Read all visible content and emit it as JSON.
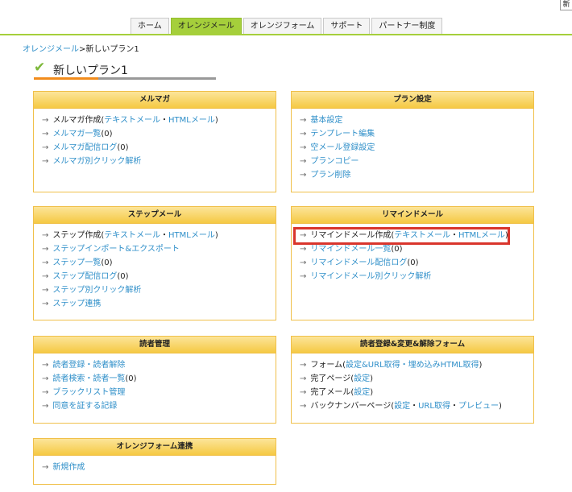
{
  "tabs": [
    "ホーム",
    "オレンジメール",
    "オレンジフォーム",
    "サポート",
    "パートナー制度"
  ],
  "active_tab": 1,
  "corner_mark": "新",
  "breadcrumb": {
    "link": "オレンジメール",
    "sep": ">",
    "current": "新しいプラン1"
  },
  "page_title": "新しいプラン1",
  "colors": {
    "accent_green": "#a5cf3b",
    "link_blue": "#2f8fc9",
    "panel_header": "#f5c943",
    "title_orange": "#f28c1c",
    "highlight_red": "#d9352c"
  },
  "panels": {
    "melmaga": {
      "title": "メルマガ",
      "create": {
        "label": "メルマガ作成",
        "open": "(",
        "text_link": "テキストメール",
        "dot": "・",
        "html_link": "HTMLメール",
        "close": ")"
      },
      "list": {
        "label": "メルマガ一覧",
        "count": "(0)"
      },
      "log": {
        "label": "メルマガ配信ログ",
        "count": "(0)"
      },
      "click": "メルマガ別クリック解析"
    },
    "plan": {
      "title": "プラン設定",
      "items": [
        "基本設定",
        "テンプレート編集",
        "空メール登録設定",
        "プランコピー",
        "プラン削除"
      ]
    },
    "step": {
      "title": "ステップメール",
      "create": {
        "label": "ステップ作成",
        "open": "(",
        "text_link": "テキストメール",
        "dot": "・",
        "html_link": "HTMLメール",
        "close": ")"
      },
      "import": "ステップインポート&エクスポート",
      "list": {
        "label": "ステップ一覧",
        "count": "(0)"
      },
      "log": {
        "label": "ステップ配信ログ",
        "count": "(0)"
      },
      "click": "ステップ別クリック解析",
      "link": "ステップ連携"
    },
    "remind": {
      "title": "リマインドメール",
      "create": {
        "label": "リマインドメール作成",
        "open": "(",
        "text_link": "テキストメール",
        "dot": "・",
        "html_link": "HTMLメール",
        "close": ")"
      },
      "list": {
        "label": "リマインドメール一覧",
        "count": "(0)"
      },
      "log": {
        "label": "リマインドメール配信ログ",
        "count": "(0)"
      },
      "click": "リマインドメール別クリック解析"
    },
    "reader": {
      "title": "読者管理",
      "register": "読者登録・読者解除",
      "search": {
        "label": "読者検索・読者一覧",
        "count": "(0)"
      },
      "blacklist": "ブラックリスト管理",
      "consent": "同意を証する記録"
    },
    "form": {
      "title": "読者登録&変更&解除フォーム",
      "form": {
        "label": "フォーム",
        "open": "(",
        "link": "設定&URL取得・埋め込みHTML取得",
        "close": ")"
      },
      "complete_page": {
        "label": "完了ページ",
        "open": "(",
        "link": "設定",
        "close": ")"
      },
      "complete_mail": {
        "label": "完了メール",
        "open": "(",
        "link": "設定",
        "close": ")"
      },
      "backnumber": {
        "label": "バックナンバーページ",
        "open": "(",
        "link1": "設定",
        "dot1": "・",
        "link2": "URL取得",
        "dot2": "・",
        "link3": "プレビュー",
        "close": ")"
      }
    },
    "orangeform": {
      "title": "オレンジフォーム連携",
      "new": "新規作成"
    }
  }
}
